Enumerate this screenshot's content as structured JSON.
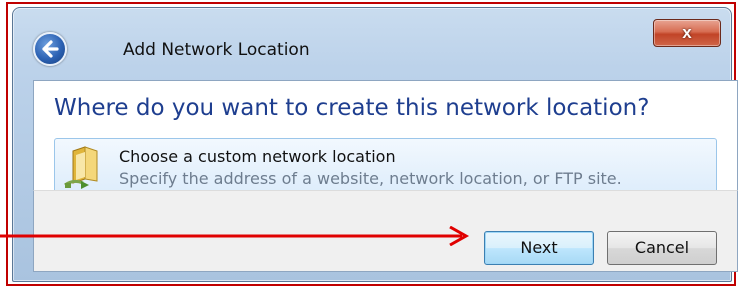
{
  "window": {
    "title": "Add Network Location",
    "close_label": "x"
  },
  "content": {
    "heading": "Where do you want to create this network location?",
    "option": {
      "title": "Choose a custom network location",
      "description": "Specify the address of a website, network location, or FTP site.",
      "icon": "folder-network-icon"
    }
  },
  "footer": {
    "next_label": "Next",
    "cancel_label": "Cancel"
  },
  "annotation": {
    "arrow_color": "#e00000",
    "frame_color": "#c00000"
  },
  "colors": {
    "heading": "#1e3e8f",
    "option_desc": "#6e7d8f"
  }
}
